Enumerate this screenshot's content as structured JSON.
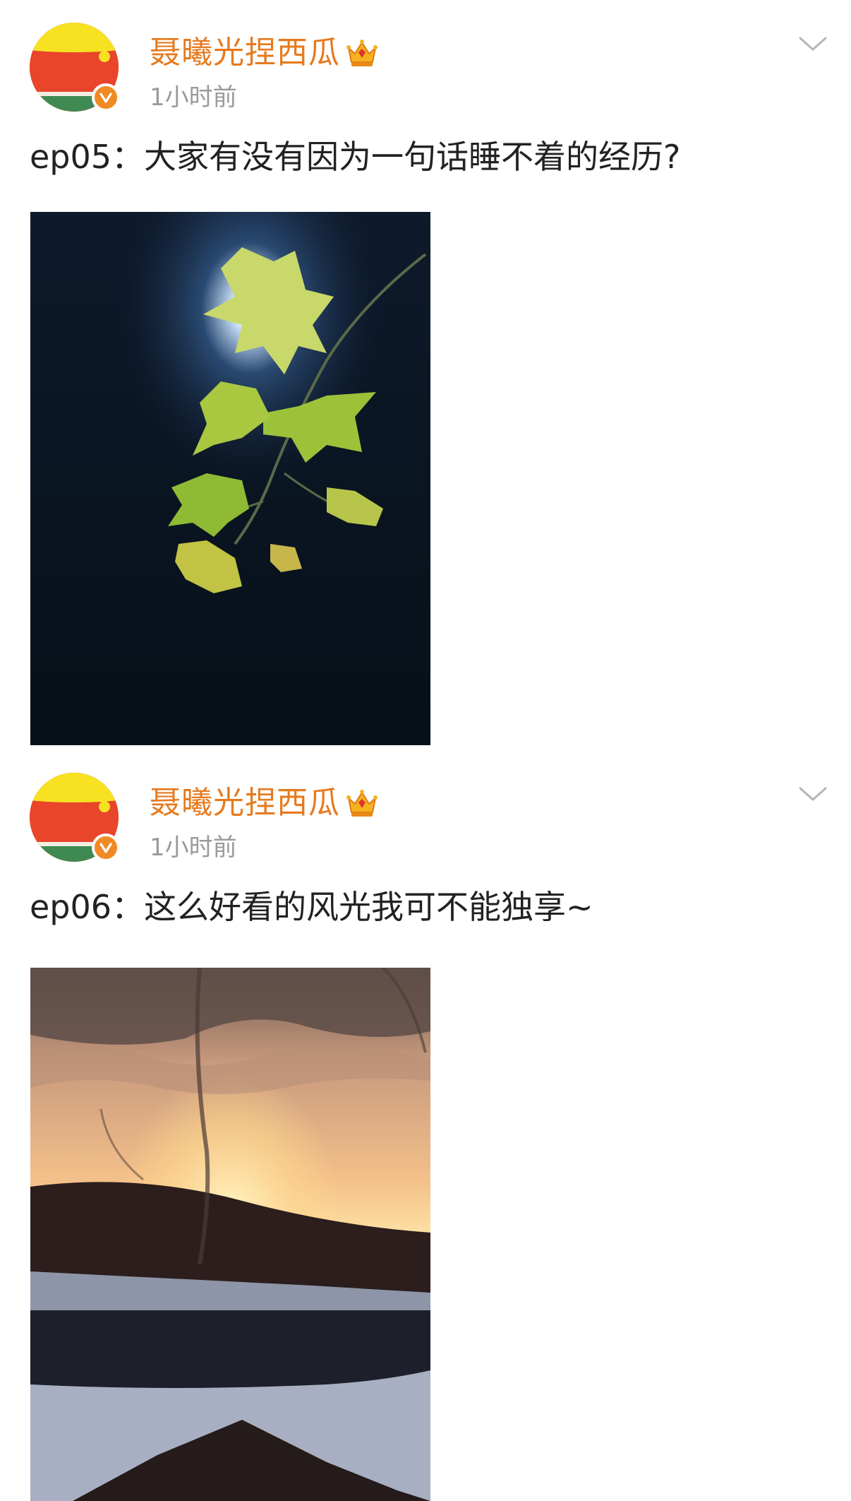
{
  "feed": {
    "posts": [
      {
        "user_name": "聂曦光捏西瓜",
        "timestamp": "1小时前",
        "text": "ep05：大家有没有因为一句话睡不着的经历?",
        "image_icon": "photo-maple-leaves-night",
        "more_icon": "chevron-down-icon",
        "badge_icon": "verified-icon",
        "member_icon": "crown-icon"
      },
      {
        "user_name": "聂曦光捏西瓜",
        "timestamp": "1小时前",
        "text": "ep06：这么好看的风光我可不能独享~",
        "image_icon": "photo-sunset-snow-hills",
        "more_icon": "chevron-down-icon",
        "badge_icon": "verified-icon",
        "member_icon": "crown-icon"
      }
    ]
  },
  "colors": {
    "user_name": "#e67a1e",
    "timestamp": "#9a9a9a",
    "body_text": "#222222",
    "verified_badge": "#f08a24",
    "background": "#ffffff"
  }
}
